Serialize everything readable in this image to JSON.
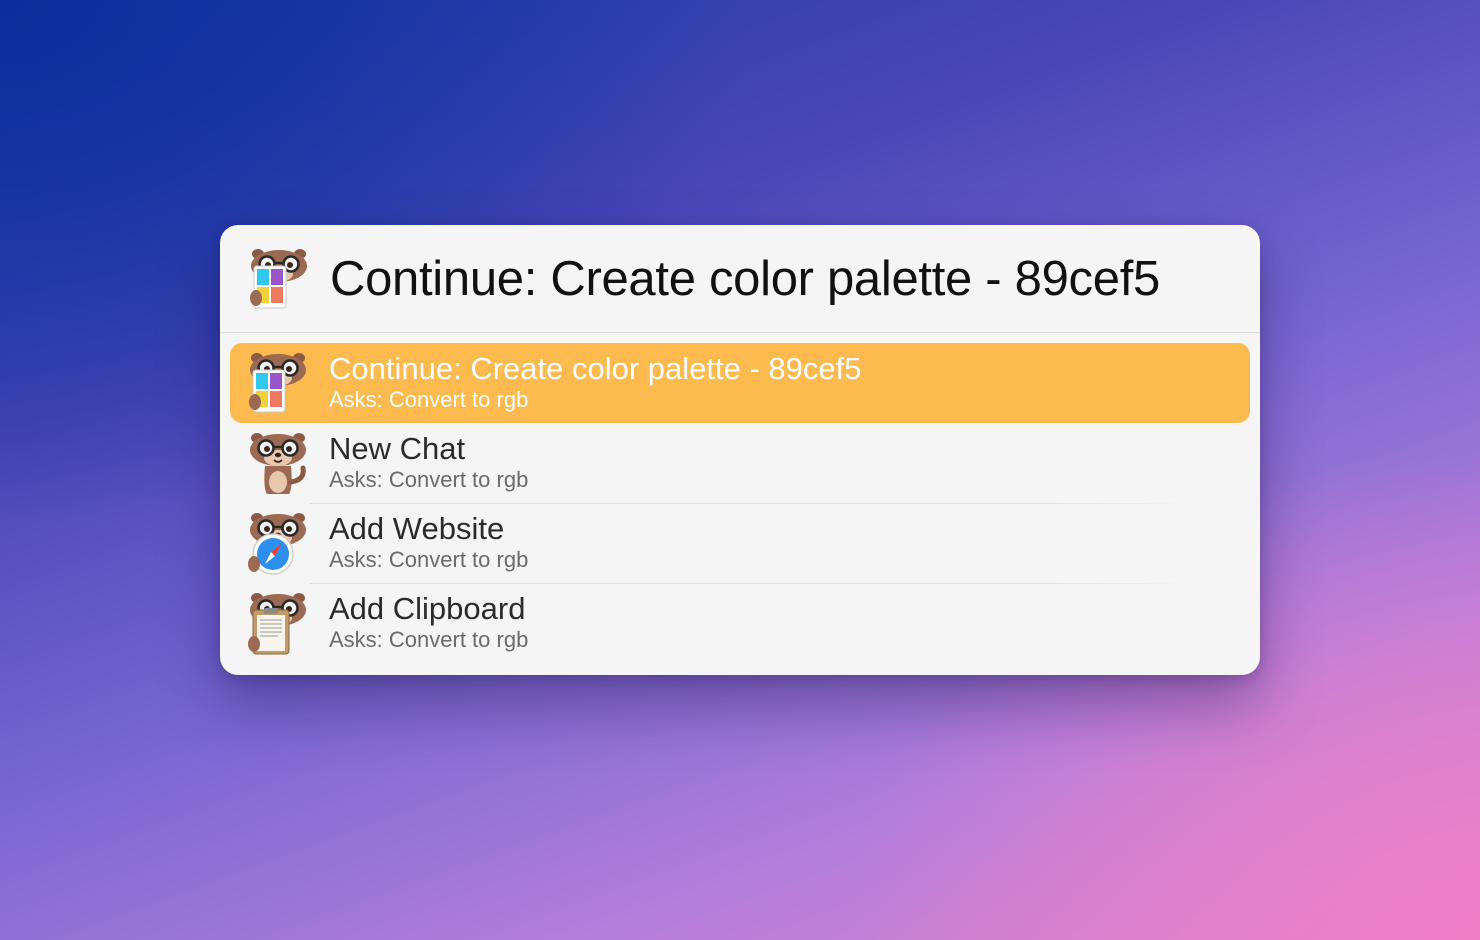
{
  "colors": {
    "accent_selected": "#fdba4f",
    "window_bg": "#f5f5f6"
  },
  "query": {
    "text": "Continue: Create color palette - 89cef5",
    "icon": "otter-color-palette-icon"
  },
  "results": [
    {
      "title": "Continue: Create color palette - 89cef5",
      "subtitle": "Asks: Convert to rgb",
      "icon": "otter-color-palette-icon",
      "selected": true
    },
    {
      "title": "New Chat",
      "subtitle": "Asks: Convert to rgb",
      "icon": "otter-icon",
      "selected": false
    },
    {
      "title": "Add Website",
      "subtitle": "Asks: Convert to rgb",
      "icon": "otter-safari-compass-icon",
      "selected": false
    },
    {
      "title": "Add Clipboard",
      "subtitle": "Asks: Convert to rgb",
      "icon": "otter-clipboard-icon",
      "selected": false
    }
  ]
}
